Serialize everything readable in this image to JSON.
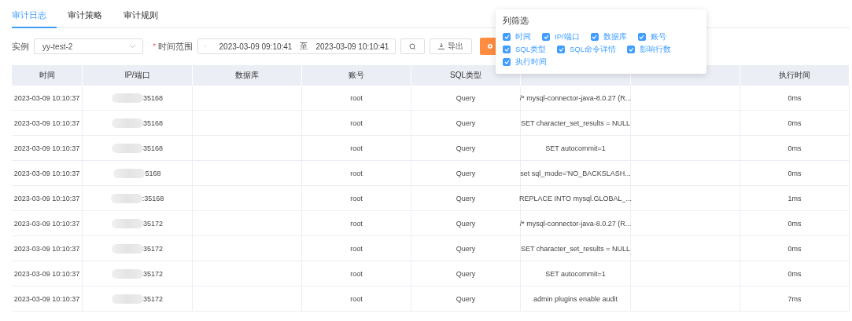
{
  "tabs": [
    {
      "label": "审计日志",
      "selected": true
    },
    {
      "label": "审计策略",
      "selected": false
    },
    {
      "label": "审计规则",
      "selected": false
    }
  ],
  "filters": {
    "instance_label": "实例",
    "instance_value": "yy-test-2",
    "range_label": "时间范围",
    "required_mark": "*",
    "start": "2023-03-09 09:10:41",
    "separator": "至",
    "end": "2023-03-09 10:10:41",
    "export_label": "导出"
  },
  "column_filter": {
    "title": "列筛选",
    "options": [
      {
        "label": "时间",
        "checked": true
      },
      {
        "label": "IP/端口",
        "checked": true
      },
      {
        "label": "数据库",
        "checked": true
      },
      {
        "label": "账号",
        "checked": true
      },
      {
        "label": "SQL类型",
        "checked": true
      },
      {
        "label": "SQL命令详情",
        "checked": true
      },
      {
        "label": "影响行数",
        "checked": true
      },
      {
        "label": "执行时间",
        "checked": true
      }
    ]
  },
  "table": {
    "columns": [
      "时间",
      "IP/端口",
      "数据库",
      "账号",
      "SQL类型",
      "执行时间"
    ],
    "rows": [
      {
        "time": "2023-03-09 10:10:37",
        "port": "35168",
        "account": "root",
        "type": "Query",
        "sql": "/* mysql-connector-java-8.0.27 (R...",
        "duration": "0ms"
      },
      {
        "time": "2023-03-09 10:10:37",
        "port": "35168",
        "account": "root",
        "type": "Query",
        "sql": "SET character_set_results = NULL",
        "duration": "0ms"
      },
      {
        "time": "2023-03-09 10:10:37",
        "port": "35168",
        "account": "root",
        "type": "Query",
        "sql": "SET autocommit=1",
        "duration": "0ms"
      },
      {
        "time": "2023-03-09 10:10:37",
        "port": "5168",
        "account": "root",
        "type": "Query",
        "sql": "set sql_mode='NO_BACKSLASH...",
        "duration": "0ms"
      },
      {
        "time": "2023-03-09 10:10:37",
        "port": ":35168",
        "account": "root",
        "type": "Query",
        "sql": "REPLACE INTO mysql.GLOBAL_...",
        "duration": "1ms"
      },
      {
        "time": "2023-03-09 10:10:37",
        "port": "35172",
        "account": "root",
        "type": "Query",
        "sql": "/* mysql-connector-java-8.0.27 (R...",
        "duration": "0ms"
      },
      {
        "time": "2023-03-09 10:10:37",
        "port": "35172",
        "account": "root",
        "type": "Query",
        "sql": "SET character_set_results = NULL",
        "duration": "0ms"
      },
      {
        "time": "2023-03-09 10:10:37",
        "port": "35172",
        "account": "root",
        "type": "Query",
        "sql": "SET autocommit=1",
        "duration": "0ms"
      },
      {
        "time": "2023-03-09 10:10:37",
        "port": "35172",
        "account": "root",
        "type": "Query",
        "sql": "admin plugins enable audit",
        "duration": "7ms"
      }
    ]
  }
}
